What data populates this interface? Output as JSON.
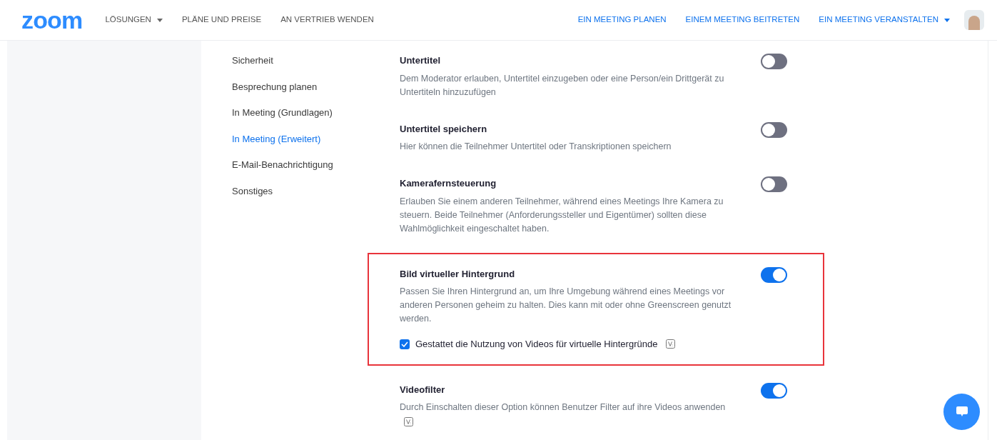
{
  "header": {
    "logo": "zoom",
    "nav_left": [
      {
        "label": "LÖSUNGEN",
        "dropdown": true
      },
      {
        "label": "PLÄNE UND PREISE",
        "dropdown": false
      },
      {
        "label": "AN VERTRIEB WENDEN",
        "dropdown": false
      }
    ],
    "nav_right": [
      {
        "label": "EIN MEETING PLANEN",
        "dropdown": false
      },
      {
        "label": "EINEM MEETING BEITRETEN",
        "dropdown": false
      },
      {
        "label": "EIN MEETING VERANSTALTEN",
        "dropdown": true
      }
    ]
  },
  "sidebar": {
    "items": [
      {
        "label": "Sicherheit",
        "selected": false
      },
      {
        "label": "Besprechung planen",
        "selected": false
      },
      {
        "label": "In Meeting (Grundlagen)",
        "selected": false
      },
      {
        "label": "In Meeting (Erweitert)",
        "selected": true
      },
      {
        "label": "E-Mail-Benachrichtigung",
        "selected": false
      },
      {
        "label": "Sonstiges",
        "selected": false
      }
    ]
  },
  "settings": [
    {
      "title": "Untertitel",
      "description": "Dem Moderator erlauben, Untertitel einzugeben oder eine Person/ein Drittgerät zu Untertiteln hinzuzufügen",
      "on": false,
      "highlighted": false,
      "info": false
    },
    {
      "title": "Untertitel speichern",
      "description": "Hier können die Teilnehmer Untertitel oder Transkriptionen speichern",
      "on": false,
      "highlighted": false,
      "info": false
    },
    {
      "title": "Kamerafernsteuerung",
      "description": "Erlauben Sie einem anderen Teilnehmer, während eines Meetings Ihre Kamera zu steuern. Beide Teilnehmer (Anforderungssteller und Eigentümer) sollten diese Wahlmöglichkeit eingeschaltet haben.",
      "on": false,
      "highlighted": false,
      "info": false
    },
    {
      "title": "Bild virtueller Hintergrund",
      "description": "Passen Sie Ihren Hintergrund an, um Ihre Umgebung während eines Meetings vor anderen Personen geheim zu halten. Dies kann mit oder ohne Greenscreen genutzt werden.",
      "on": true,
      "highlighted": true,
      "info": false,
      "option": {
        "label": "Gestattet die Nutzung von Videos für virtuelle Hintergründe",
        "checked": true,
        "info": true
      }
    },
    {
      "title": "Videofilter",
      "description": "Durch Einschalten dieser Option können Benutzer Filter auf ihre Videos anwenden",
      "on": true,
      "highlighted": false,
      "info": true
    }
  ]
}
